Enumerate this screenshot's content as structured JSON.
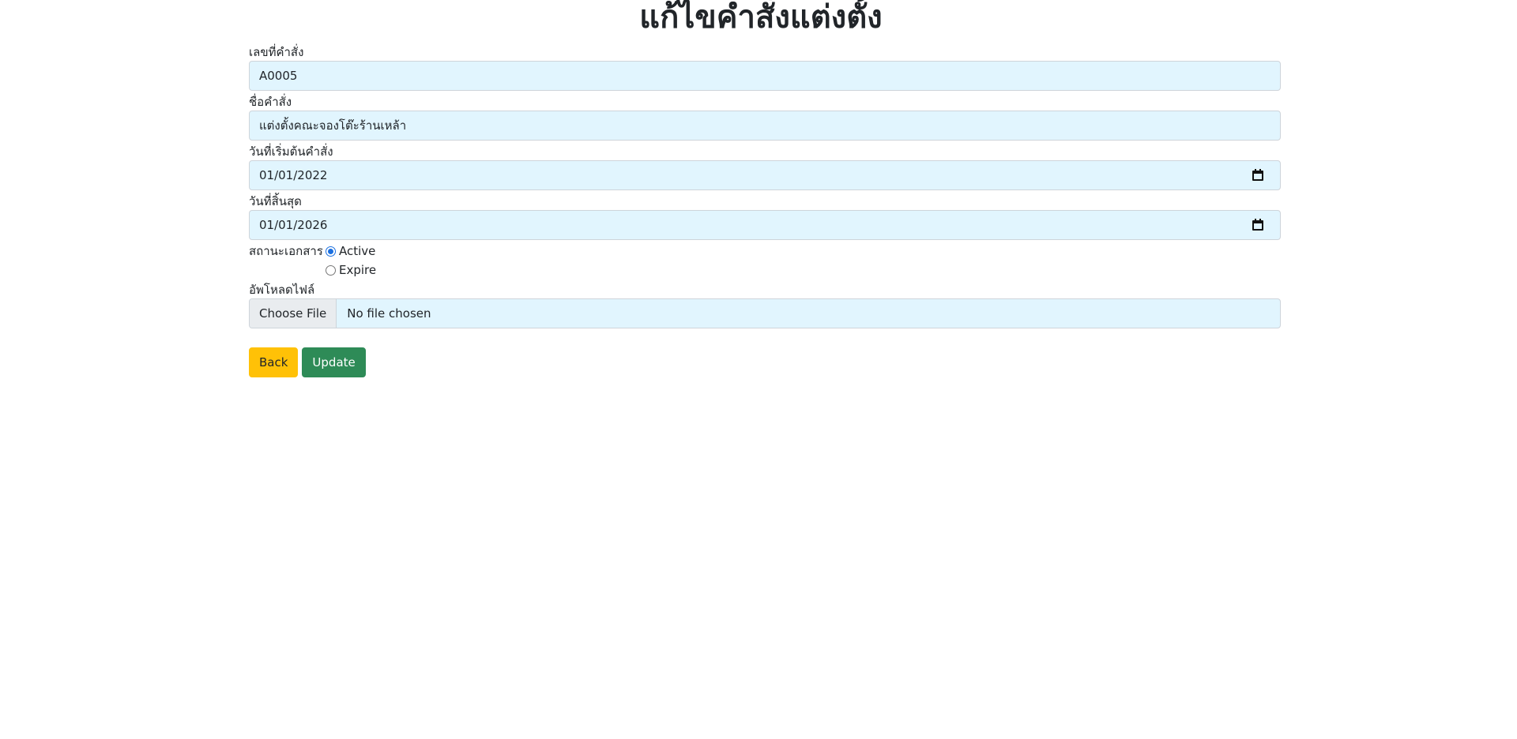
{
  "page": {
    "title": "แก้ไขคำสั่งแต่งตั้ง"
  },
  "form": {
    "order_number": {
      "label": "เลขที่คำสั่ง",
      "value": "A0005"
    },
    "order_name": {
      "label": "ชื่อคำสั่ง",
      "value": "แต่งตั้งคณะจองโต๊ะร้านเหล้า"
    },
    "start_date": {
      "label": "วันที่เริ่มต้นคำสั่ง",
      "value": "01/01/2022"
    },
    "end_date": {
      "label": "วันที่สิ้นสุด",
      "value": "01/01/2026"
    },
    "status": {
      "label": "สถานะเอกสาร",
      "options": [
        {
          "label": "Active",
          "checked": true
        },
        {
          "label": "Expire",
          "checked": false
        }
      ]
    },
    "upload": {
      "label": "อัพโหลดไฟล์",
      "button_label": "Choose File",
      "file_name": "No file chosen"
    }
  },
  "actions": {
    "back_label": "Back",
    "update_label": "Update"
  },
  "colors": {
    "input_bg": "#e1f5fe",
    "back_button": "#ffc107",
    "update_button": "#2e8b57",
    "radio_accent": "#1a6fe0"
  }
}
